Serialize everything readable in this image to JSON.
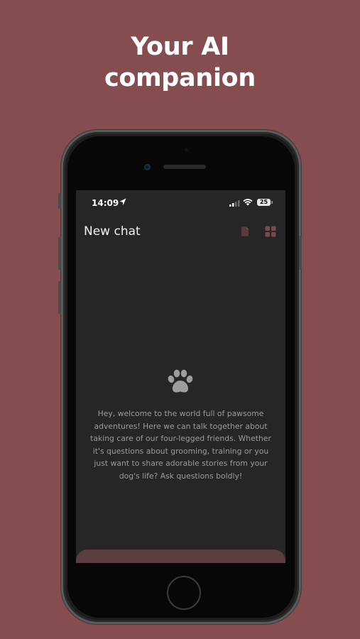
{
  "headline": {
    "line1": "Your AI",
    "line2": "companion"
  },
  "status_bar": {
    "time": "14:09",
    "battery": "25"
  },
  "app": {
    "title": "New chat",
    "icons": {
      "location": "location-arrow-icon",
      "signal": "signal-bars-icon",
      "wifi": "wifi-icon",
      "document": "document-icon",
      "grid": "grid-icon",
      "paw": "paw-icon"
    }
  },
  "chat": {
    "welcome_message": "Hey, welcome to the world full of pawsome adventures! Here we can talk together about taking care of our four-legged friends. Whether it's questions about grooming, training or you just want to share adorable stories from your dog's life? Ask questions boldly!"
  },
  "colors": {
    "background": "#854d4f",
    "screen": "#262626",
    "accent": "#7a4a4c",
    "text_muted": "#9b9b9b"
  }
}
